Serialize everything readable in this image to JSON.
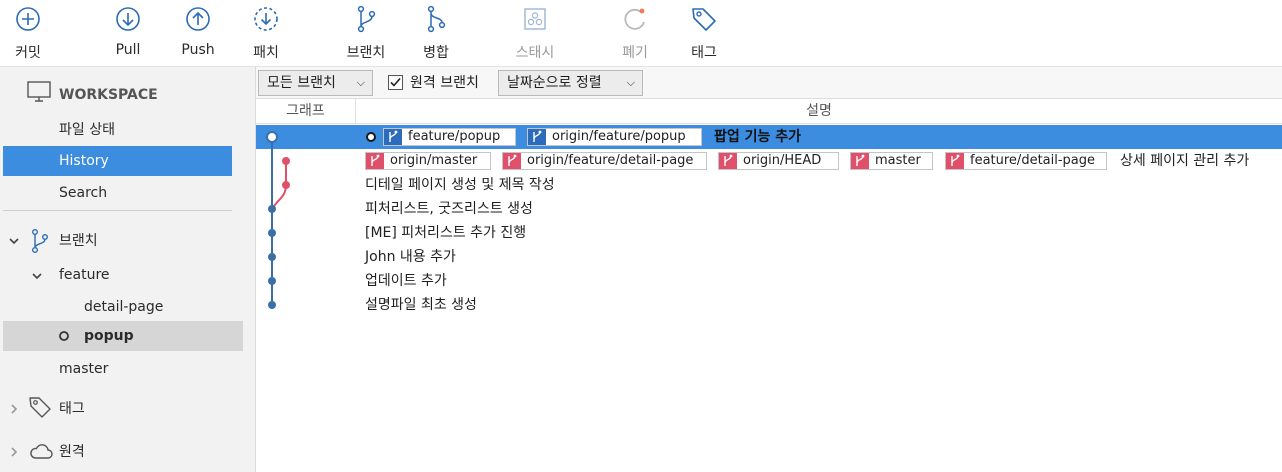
{
  "toolbar": {
    "commit": "커밋",
    "pull": "Pull",
    "push": "Push",
    "fetch": "패치",
    "branch": "브랜치",
    "merge": "병합",
    "stash": "스태시",
    "discard": "폐기",
    "tag": "태그"
  },
  "sidebar": {
    "workspace": "WORKSPACE",
    "file_status": "파일 상태",
    "history": "History",
    "search": "Search",
    "branches": "브랜치",
    "feature": "feature",
    "detail_page": "detail-page",
    "popup": "popup",
    "master": "master",
    "tags": "태그",
    "remotes": "원격"
  },
  "filter": {
    "all_branches": "모든 브랜치",
    "remote_branches": "원격 브랜치",
    "remote_checked": true,
    "sort": "날짜순으로 정렬"
  },
  "columns": {
    "graph": "그래프",
    "description": "설명"
  },
  "commits": [
    {
      "refs": [
        "feature/popup",
        "origin/feature/popup"
      ],
      "message": "팝업 기능 추가",
      "selected": true
    },
    {
      "refs": [
        "origin/master",
        "origin/feature/detail-page",
        "origin/HEAD",
        "master",
        "feature/detail-page"
      ],
      "message": "상세 페이지 관리 추가"
    },
    {
      "refs": [],
      "message": "디테일 페이지 생성 및 제목 작성"
    },
    {
      "refs": [],
      "message": "피처리스트, 굿즈리스트 생성"
    },
    {
      "refs": [],
      "message": "[ME] 피처리스트 추가 진행"
    },
    {
      "refs": [],
      "message": "John 내용 추가"
    },
    {
      "refs": [],
      "message": "업데이트 추가"
    },
    {
      "refs": [],
      "message": "설명파일 최초 생성"
    }
  ],
  "colors": {
    "accent": "#3c8de0",
    "branch_blue": "#2d6cbd",
    "branch_red": "#e0506b",
    "graph_blue": "#3a6ea8"
  }
}
